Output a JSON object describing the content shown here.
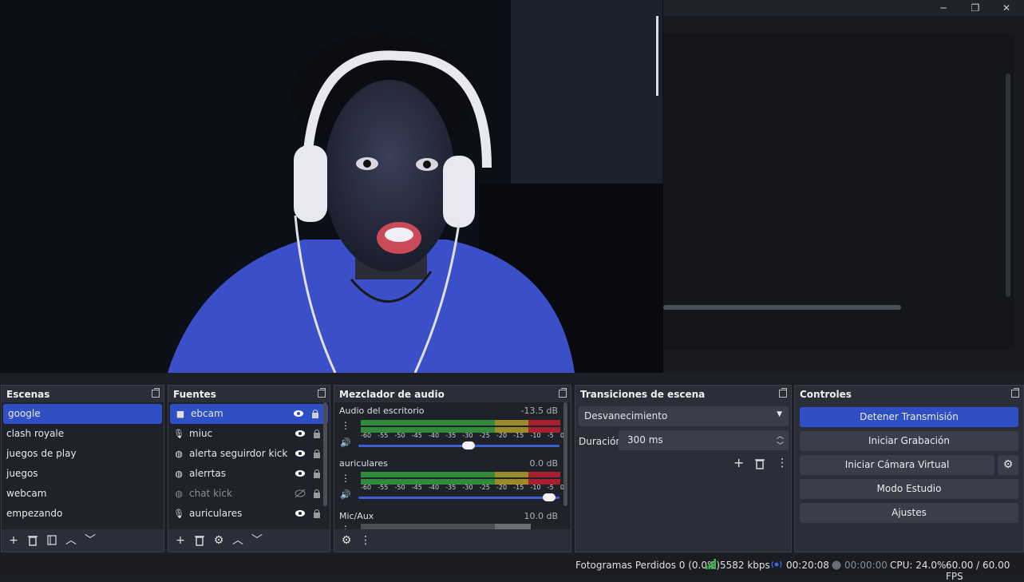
{
  "window": {
    "minimize_label": "─",
    "maximize_label": "❐",
    "close_label": "✕"
  },
  "scenes": {
    "title": "Escenas",
    "items": [
      "google",
      "clash royale",
      "juegos de play",
      "juegos",
      "webcam",
      "empezando"
    ]
  },
  "sources": {
    "title": "Fuentes",
    "items": [
      {
        "label": "ebcam",
        "icon": "camera-icon"
      },
      {
        "label": "miuc",
        "icon": "microphone-icon"
      },
      {
        "label": "alerta seguirdor kick",
        "icon": "globe-icon"
      },
      {
        "label": "alerrtas",
        "icon": "globe-icon"
      },
      {
        "label": "chat kick",
        "icon": "globe-icon"
      },
      {
        "label": "auriculares",
        "icon": "microphone-icon"
      }
    ]
  },
  "mixer": {
    "title": "Mezclador de audio",
    "scale": [
      "-60",
      "-55",
      "-50",
      "-45",
      "-40",
      "-35",
      "-30",
      "-25",
      "-20",
      "-15",
      "-10",
      "-5",
      "0"
    ],
    "channels": [
      {
        "name": "Audio del escritorio",
        "db": "-13.5 dB",
        "level": 0.58
      },
      {
        "name": "auriculares",
        "db": "0.0 dB",
        "level": 0.98
      },
      {
        "name": "Mic/Aux",
        "db": "10.0 dB"
      }
    ]
  },
  "transitions": {
    "title": "Transiciones de escena",
    "selected": "Desvanecimiento",
    "duration_label": "Duración",
    "duration_value": "300 ms"
  },
  "controls": {
    "title": "Controles",
    "stop_stream": "Detener Transmisión",
    "start_recording": "Iniciar Grabación",
    "start_virtual_cam": "Iniciar Cámara Virtual",
    "studio_mode": "Modo Estudio",
    "settings": "Ajustes"
  },
  "status": {
    "dropped_frames": "Fotogramas Perdidos 0 (0.0%)",
    "bitrate": "5582 kbps",
    "stream_time": "00:20:08",
    "record_time": "00:00:00",
    "cpu": "CPU: 24.0%",
    "fps": "60.00 / 60.00 FPS"
  },
  "colors": {
    "accent": "#2f4fc4",
    "dock_bg": "#2b2e38",
    "meter_green": "#2f8a3a",
    "meter_yellow": "#9a8a2a",
    "meter_red": "#a81f2d"
  }
}
